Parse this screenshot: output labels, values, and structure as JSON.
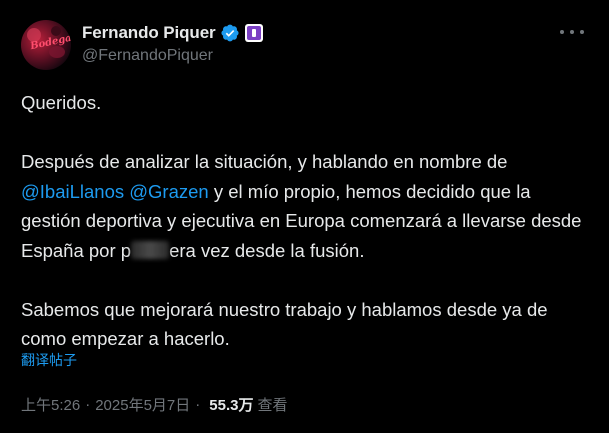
{
  "author": {
    "display_name": "Fernando Piquer",
    "handle": "@FernandoPiquer",
    "avatar_text": "Bodega"
  },
  "tweet": {
    "line1": "Queridos.",
    "p2_a": "Después de analizar la situación, y hablando en nombre de",
    "mention1": "@IbaiLlanos",
    "mention2": "@Grazen",
    "p2_b": " y el mío propio, hemos decidido que la gestión deportiva y ejecutiva en Europa comenzará a llevarse desde España por p",
    "p2_c": "era vez desde la fusión.",
    "p3": "Sabemos que mejorará nuestro trabajo y hablamos desde ya de como empezar a hacerlo."
  },
  "translate_label": "翻译帖子",
  "meta": {
    "time": "上午5:26",
    "date": "2025年5月7日",
    "separator": "·",
    "views_count": "55.3万",
    "views_label": "查看"
  },
  "colors": {
    "background": "#000000",
    "text": "#e7e9ea",
    "secondary": "#71767b",
    "link": "#1d9bf0",
    "verified": "#1d9bf0"
  }
}
